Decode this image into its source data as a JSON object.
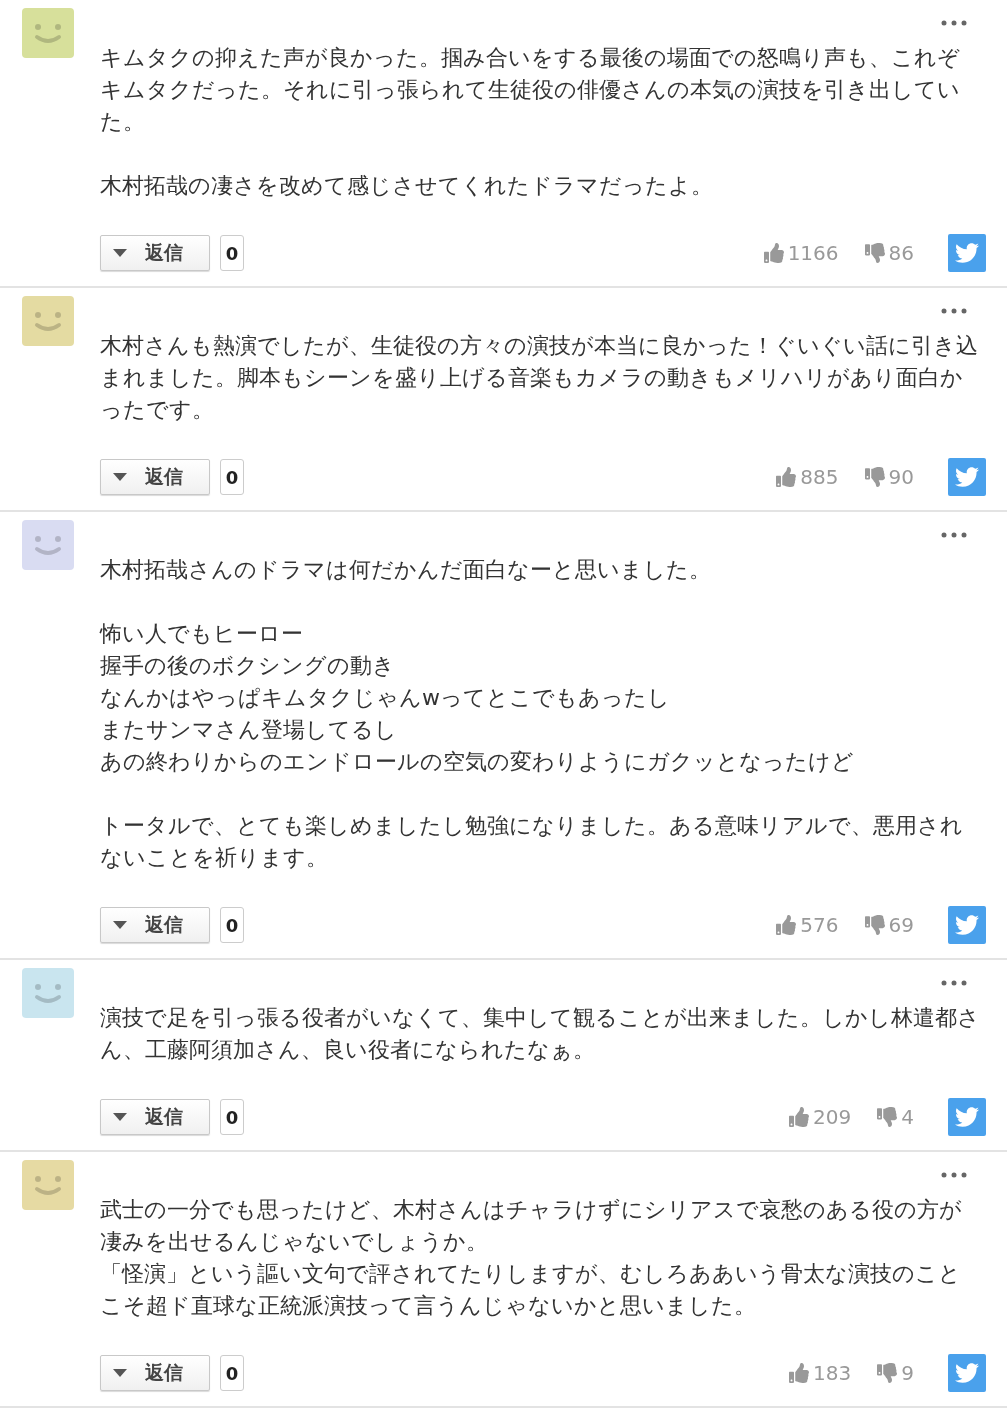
{
  "comments": [
    {
      "color": "#d7e09b",
      "paragraphs": [
        [
          "キムタクの抑えた声が良かった。掴み合いをする最後の場面での怒鳴り声も、これぞキムタクだった。それに引っ張られて生徒役の俳優さんの本気の演技を引き出していた。"
        ],
        [
          "木村拓哉の凄さを改めて感じさせてくれたドラマだったよ。"
        ]
      ],
      "reply_label": "返信",
      "reply_count": "0",
      "likes": "1166",
      "dislikes": "86"
    },
    {
      "color": "#e4dba2",
      "paragraphs": [
        [
          "木村さんも熱演でしたが、生徒役の方々の演技が本当に良かった！ぐいぐい話に引き込まれました。脚本もシーンを盛り上げる音楽もカメラの動きもメリハリがあり面白かったです。"
        ]
      ],
      "reply_label": "返信",
      "reply_count": "0",
      "likes": "885",
      "dislikes": "90"
    },
    {
      "color": "#d9dcf2",
      "paragraphs": [
        [
          "木村拓哉さんのドラマは何だかんだ面白なーと思いました。"
        ],
        [
          "怖い人でもヒーロー",
          "握手の後のボクシングの動き",
          "なんかはやっぱキムタクじゃんwってとこでもあったし",
          "またサンマさん登場してるし",
          "あの終わりからのエンドロールの空気の変わりようにガクッとなったけど"
        ],
        [
          "トータルで、とても楽しめましたし勉強になりました。ある意味リアルで、悪用されないことを祈ります。"
        ]
      ],
      "reply_label": "返信",
      "reply_count": "0",
      "likes": "576",
      "dislikes": "69"
    },
    {
      "color": "#c9e5ef",
      "paragraphs": [
        [
          "演技で足を引っ張る役者がいなくて、集中して観ることが出来ました。しかし林遣都さん、工藤阿須加さん、良い役者になられたなぁ。"
        ]
      ],
      "reply_label": "返信",
      "reply_count": "0",
      "likes": "209",
      "dislikes": "4"
    },
    {
      "color": "#e6daa3",
      "paragraphs": [
        [
          "武士の一分でも思ったけど、木村さんはチャラけずにシリアスで哀愁のある役の方が凄みを出せるんじゃないでしょうか。",
          "「怪演」という謳い文句で評されてたりしますが、むしろああいう骨太な演技のことこそ超ド直球な正統派演技って言うんじゃないかと思いました。"
        ]
      ],
      "reply_label": "返信",
      "reply_count": "0",
      "likes": "183",
      "dislikes": "9"
    }
  ]
}
